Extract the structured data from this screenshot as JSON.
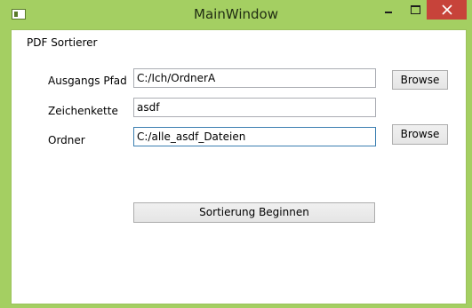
{
  "window": {
    "title": "MainWindow"
  },
  "heading": "PDF Sortierer",
  "rows": [
    {
      "label": "Ausgangs Pfad",
      "value": "C:/Ich/OrdnerA",
      "button": "Browse"
    },
    {
      "label": "Zeichenkette",
      "value": "asdf"
    },
    {
      "label": "Ordner",
      "value": "C:/alle_asdf_Dateien",
      "button": "Browse"
    }
  ],
  "start_button": "Sortierung Beginnen",
  "colors": {
    "frame": "#a4cf62",
    "close": "#c7433a",
    "focus": "#3c7fb1"
  }
}
